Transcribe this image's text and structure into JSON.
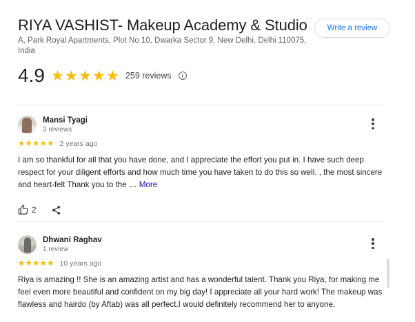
{
  "business": {
    "name": "RIYA VASHIST- Makeup Academy & Studio",
    "address": "A, Park Royal Apartments, Plot No 10, Dwarka Sector 9, New Delhi, Delhi 110075, India",
    "write_review_label": "Write a review"
  },
  "rating": {
    "value": "4.9",
    "stars": 5,
    "review_count_label": "259 reviews",
    "info_glyph": "i"
  },
  "colors": {
    "star": "#fbbc04",
    "accent": "#1a73e8",
    "link": "#1a0dab"
  },
  "reviews": [
    {
      "name": "Mansi Tyagi",
      "meta": "3 reviews",
      "stars": 5,
      "time": "2 years ago",
      "text": "I am so thankful for all that you have done, and I appreciate the effort you put in. I have such deep respect for your diligent efforts and how much time you have taken to do this so well. , the most sincere and heart-felt Thank you to the",
      "more_label": "… More",
      "like_count": "2",
      "like_icon": "thumbs-up-icon",
      "share_icon": "share-icon"
    },
    {
      "name": "Dhwani Raghav",
      "meta": "1 review",
      "stars": 5,
      "time": "10 years ago",
      "text": "Riya is amazing !! She is an amazing artist and has a wonderful talent. Thank you Riya, for making me feel even more beautiful and confident on my big day! I appreciate all your hard work! The makeup was flawless and hairdo (by Aftab) was all perfect.I would definitely recommend her to anyone."
    }
  ]
}
